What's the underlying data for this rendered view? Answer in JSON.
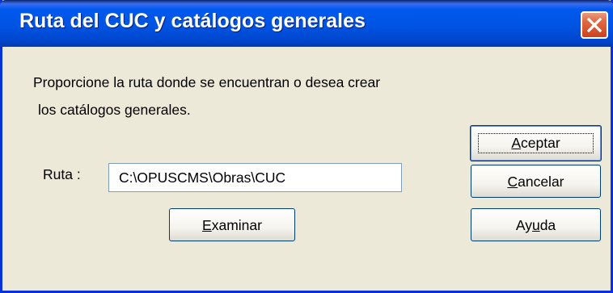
{
  "window": {
    "title": "Ruta del CUC y catálogos generales",
    "close_icon": "close-icon"
  },
  "prompt": {
    "line1": "Proporcione la ruta donde se encuentran o desea crear",
    "line2": "los catálogos generales."
  },
  "form": {
    "ruta_label": "Ruta :",
    "ruta_value": "C:\\OPUSCMS\\Obras\\CUC"
  },
  "buttons": {
    "aceptar": {
      "mnemonic": "A",
      "rest": "ceptar"
    },
    "cancelar": {
      "mnemonic": "C",
      "rest": "ancelar"
    },
    "ayuda_pre": "Ay",
    "ayuda_mnemonic": "u",
    "ayuda_post": "da",
    "examinar": {
      "mnemonic": "E",
      "rest": "xaminar"
    }
  },
  "colors": {
    "titlebar": "#0054e3",
    "dialog_bg": "#ece9d8",
    "close_button": "#e06a45"
  }
}
